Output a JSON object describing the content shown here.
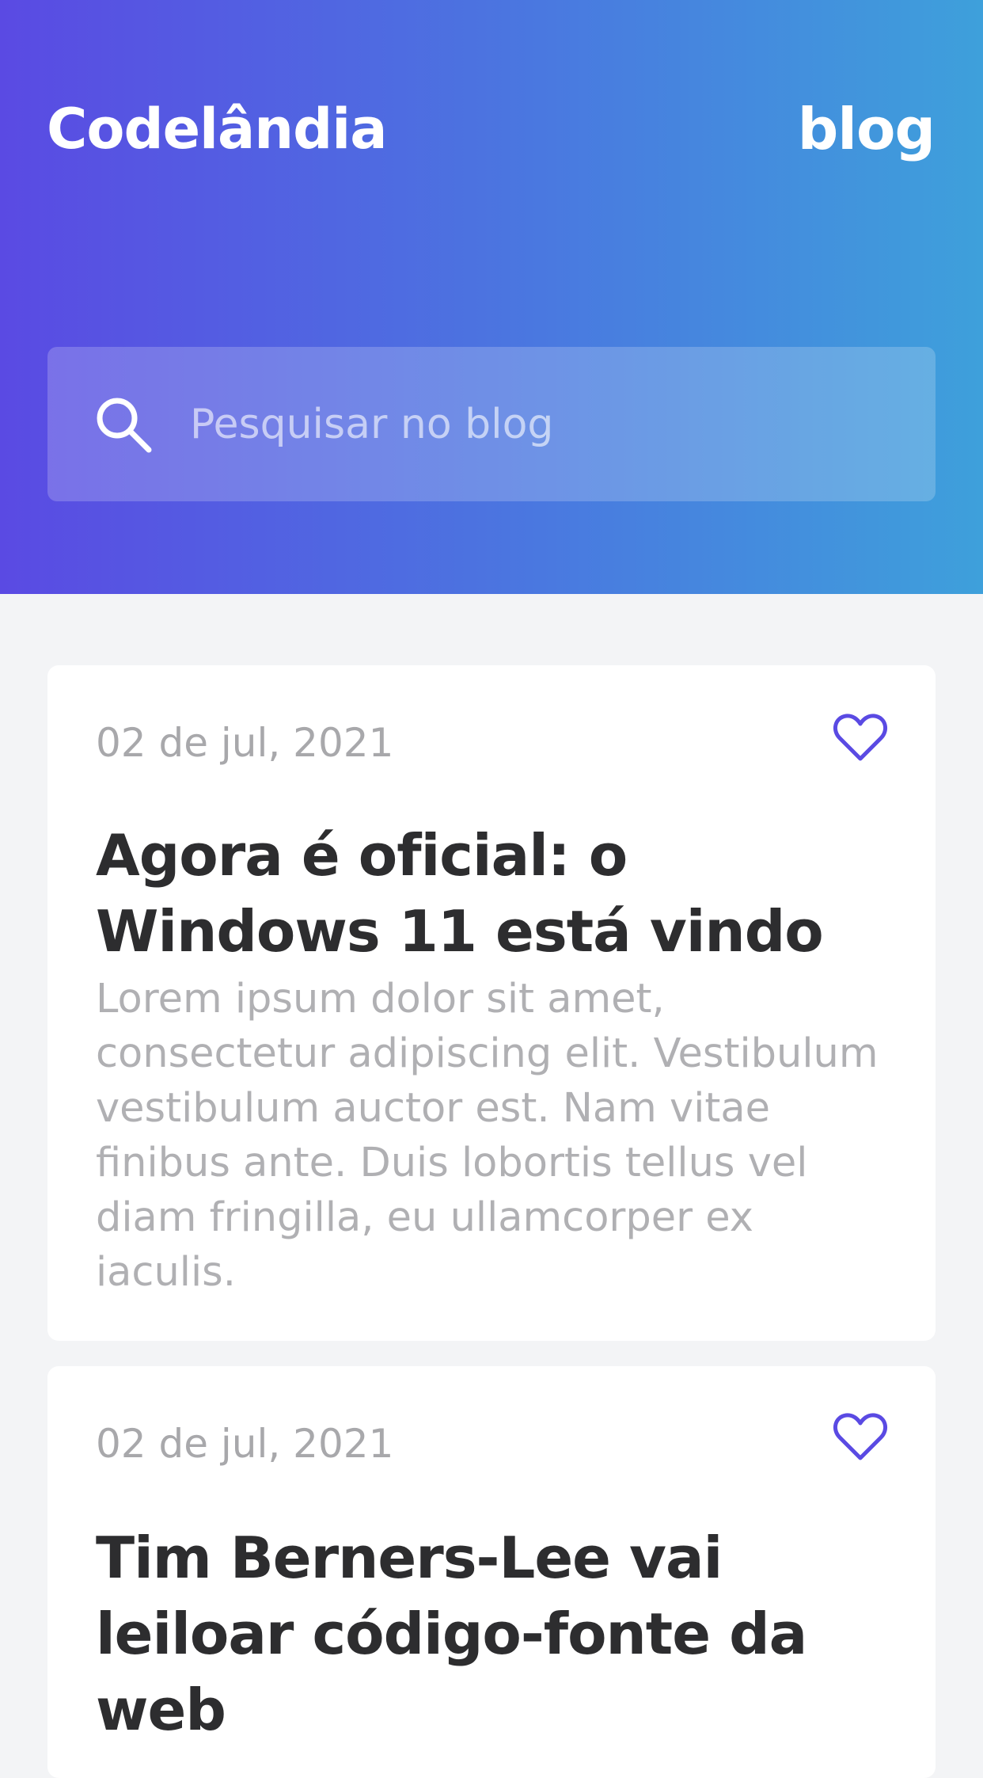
{
  "header": {
    "brand": "Codelândia",
    "blog_link": "blog"
  },
  "search": {
    "placeholder": "Pesquisar no blog",
    "icon": "search-icon"
  },
  "posts": [
    {
      "date": "02 de jul, 2021",
      "title": "Agora é oficial: o Windows 11 está vindo",
      "excerpt": "Lorem ipsum dolor sit amet, consectetur adipiscing elit. Vestibulum vestibulum auctor est. Nam vitae finibus ante. Duis lobortis tellus vel diam fringilla, eu ullamcorper ex iaculis.",
      "icon": "heart-icon"
    },
    {
      "date": "02 de jul, 2021",
      "title": "Tim Berners-Lee vai leiloar código-fonte da web",
      "icon": "heart-icon"
    }
  ],
  "colors": {
    "accent": "#5a4ae3",
    "gradient_start": "#5a4ae3",
    "gradient_end": "#3ea0db",
    "background": "#f3f4f6"
  }
}
